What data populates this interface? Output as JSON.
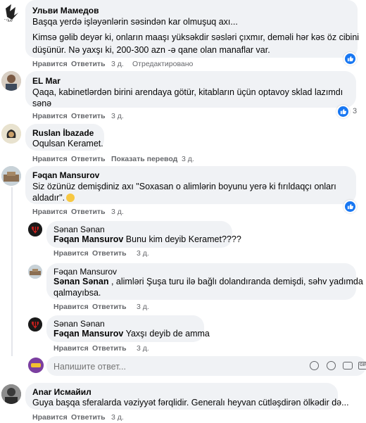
{
  "actions": {
    "like": "Нравится",
    "reply": "Ответить",
    "translate": "Показать перевод"
  },
  "comments": [
    {
      "name": "Ульви Мамедов",
      "line1": "Başqa yerdə işləyənlərin səsindən kar olmuşuq axı...",
      "line2": "Kimsə gəlib deyər ki, onların maaşı yüksəkdir səsləri çıxmır, deməli hər kəs öz cibini",
      "line3": "düşünür. Nə yaxşı ki, 200-300 azn -ə qane olan manaflar var.",
      "time": "3 д.",
      "edited": "Отредактировано"
    },
    {
      "name": "EL Mar",
      "line1": "Qaqa, kabinetlərdən birini arendaya götür, kitabların üçün optavoy sklad lazımdı",
      "line2": "sənə",
      "time": "3 д.",
      "reaction_count": "3"
    },
    {
      "name": "Ruslan İbazade",
      "line1": "Oqulsan Keramet.",
      "time": "3 д."
    },
    {
      "name": "Fəqan Mansurov",
      "line1": "Siz özünüz demişdiniz axı \"Soxasan o alimlərin boyunu yerə ki fırıldaqçı onları",
      "line2": "aldadır\".",
      "time": "3 д."
    },
    {
      "name": "Anar Исмайил",
      "line1": "Guya başqa sferalarda vəziyyət fərqlidir. Generalı heyvan cütləşdirən ölkədir də...",
      "time": "3 д."
    }
  ],
  "replies": [
    {
      "name": "Sənan Sənan",
      "mention": "Fəqan Mansurov",
      "text": " Bunu kim deyib Keramet????",
      "time": "3 д."
    },
    {
      "name": "Fəqan Mansurov",
      "mention": "Sənan Sənan",
      "text": " , alimləri Şuşa turu ilə bağlı dolandıranda demişdi, səhv yadımda",
      "text2": "qalmayıbsa.",
      "time": "3 д."
    },
    {
      "name": "Sənan Sənan",
      "mention": "Fəqan Mansurov",
      "text": " Yaxşı deyib de amma",
      "time": "3 д."
    }
  ],
  "reply_input": {
    "placeholder": "Напишите ответ..."
  },
  "colors": {
    "like": "#1877f2",
    "meta": "#65676b",
    "bubble": "#f0f2f5"
  }
}
